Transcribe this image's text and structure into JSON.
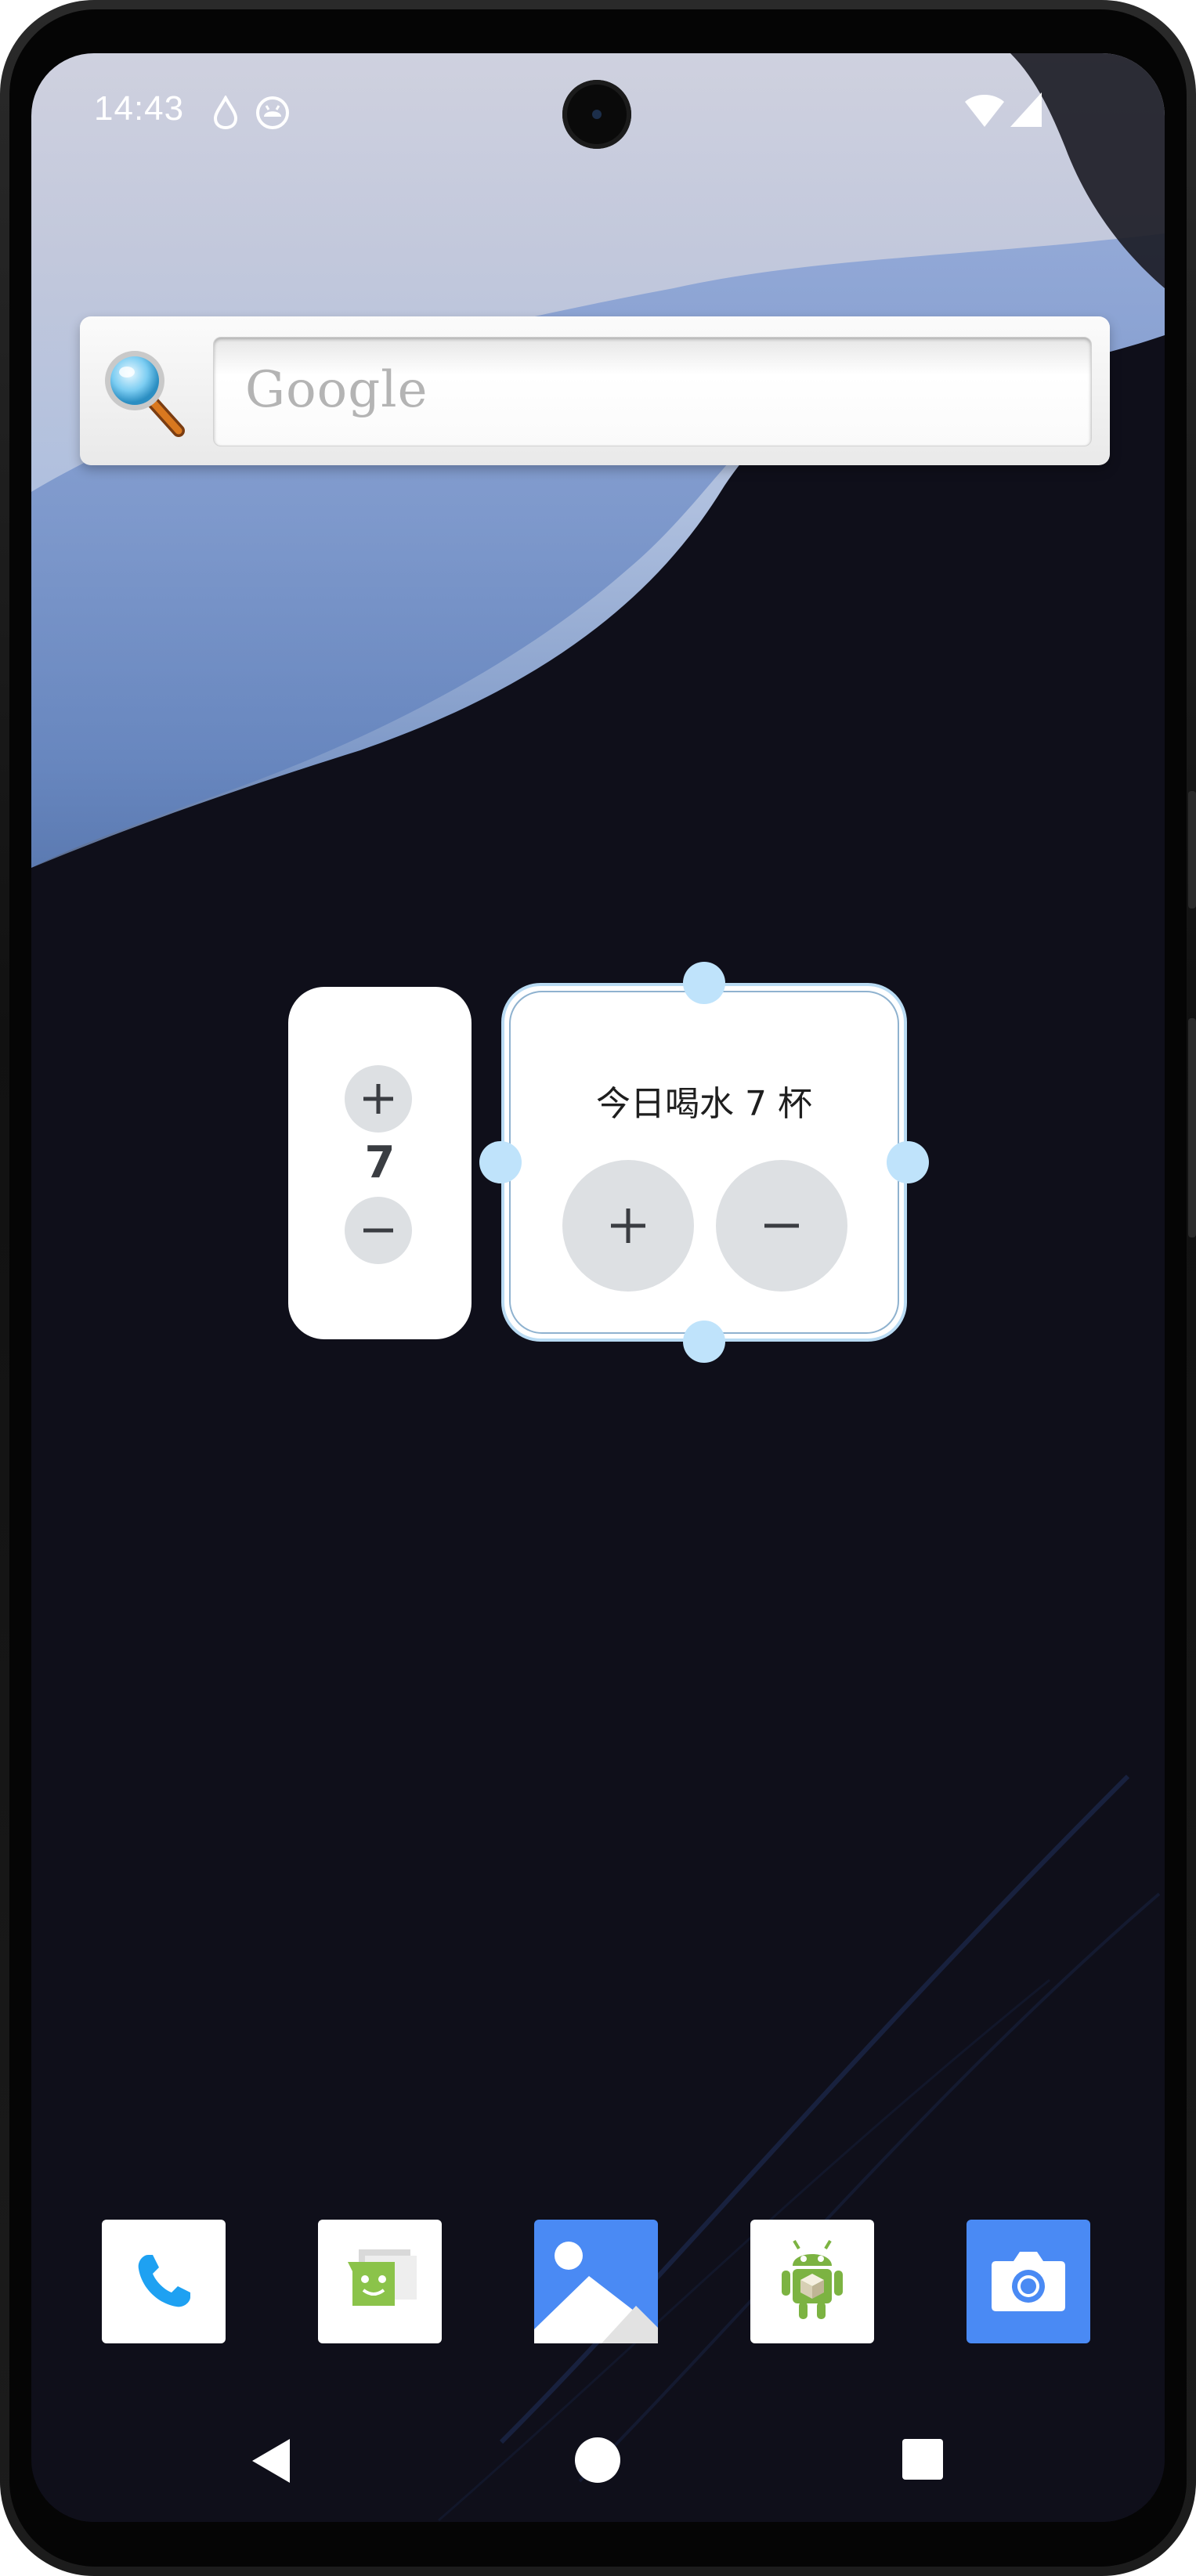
{
  "status_bar": {
    "time": "14:43",
    "left_icons": [
      "water-drop-icon",
      "android-status-icon"
    ],
    "right_icons": [
      "wifi-icon",
      "cellular-signal-icon"
    ]
  },
  "search_widget": {
    "placeholder": "Google",
    "icon": "magnifier-icon"
  },
  "water_widget_small": {
    "count": "7",
    "plus_label": "+",
    "minus_label": "−"
  },
  "water_widget_main": {
    "title": "今日喝水 7 杯",
    "plus_label": "+",
    "minus_label": "−",
    "state": "selected-resizing"
  },
  "dock": {
    "apps": [
      {
        "id": "phone",
        "icon": "phone-icon"
      },
      {
        "id": "messages",
        "icon": "messages-icon"
      },
      {
        "id": "gallery",
        "icon": "gallery-icon"
      },
      {
        "id": "android-app",
        "icon": "android-robot-icon"
      },
      {
        "id": "camera",
        "icon": "camera-icon"
      }
    ]
  },
  "nav_bar": {
    "buttons": [
      "back-icon",
      "home-icon",
      "recents-icon"
    ]
  },
  "colors": {
    "accent_blue": "#4a8af4",
    "handle_blue": "#bfe3fb",
    "button_gray": "#dde0e3",
    "wallpaper_dark": "#0f0f1a"
  }
}
